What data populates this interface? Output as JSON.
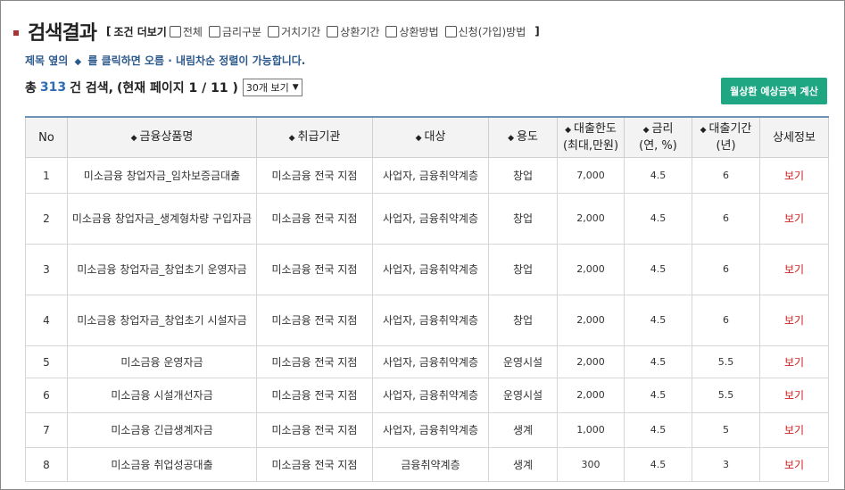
{
  "page": {
    "title": "검색결과",
    "conditions": {
      "open_bracket": "[",
      "label": "조건 더보기",
      "close_bracket": "]",
      "items": [
        "전체",
        "금리구분",
        "거치기간",
        "상환기간",
        "상환방법",
        "신청(가입)방법"
      ]
    },
    "hint": {
      "before": "제목 옆의",
      "glyph": "◆",
      "after": "를 클릭하면 오름 · 내림차순 정렬이 가능합니다."
    },
    "summary": {
      "prefix": "총",
      "total": "313",
      "suffix": "건 검색,",
      "page_text": "(현재 페이지 1 / 11 )",
      "per_page": "30개 보기"
    },
    "calc_button": "월상환 예상금액 계산"
  },
  "table": {
    "headers": [
      {
        "label": "No",
        "sortable": false
      },
      {
        "label": "금융상품명",
        "sortable": true
      },
      {
        "label": "취급기관",
        "sortable": true
      },
      {
        "label": "대상",
        "sortable": true
      },
      {
        "label": "용도",
        "sortable": true
      },
      {
        "label": "대출한도",
        "sub": "(최대,만원)",
        "sortable": true
      },
      {
        "label": "금리",
        "sub": "(연, %)",
        "sortable": true
      },
      {
        "label": "대출기간",
        "sub": "(년)",
        "sortable": true
      },
      {
        "label": "상세정보",
        "sortable": false
      }
    ],
    "rows": [
      {
        "no": "1",
        "name": "미소금융 창업자금_임차보증금대출",
        "agency": "미소금융 전국 지점",
        "target": "사업자, 금융취약계층",
        "use": "창업",
        "limit": "7,000",
        "rate": "4.5",
        "period": "6",
        "detail": "보기"
      },
      {
        "no": "2",
        "name": "미소금융 창업자금_생계형차량 구입자금",
        "agency": "미소금융 전국 지점",
        "target": "사업자, 금융취약계층",
        "use": "창업",
        "limit": "2,000",
        "rate": "4.5",
        "period": "6",
        "detail": "보기"
      },
      {
        "no": "3",
        "name": "미소금융 창업자금_창업초기 운영자금",
        "agency": "미소금융 전국 지점",
        "target": "사업자, 금융취약계층",
        "use": "창업",
        "limit": "2,000",
        "rate": "4.5",
        "period": "6",
        "detail": "보기"
      },
      {
        "no": "4",
        "name": "미소금융 창업자금_창업초기 시설자금",
        "agency": "미소금융 전국 지점",
        "target": "사업자, 금융취약계층",
        "use": "창업",
        "limit": "2,000",
        "rate": "4.5",
        "period": "6",
        "detail": "보기"
      },
      {
        "no": "5",
        "name": "미소금융 운영자금",
        "agency": "미소금융 전국 지점",
        "target": "사업자, 금융취약계층",
        "use": "운영시설",
        "limit": "2,000",
        "rate": "4.5",
        "period": "5.5",
        "detail": "보기"
      },
      {
        "no": "6",
        "name": "미소금융 시설개선자금",
        "agency": "미소금융 전국 지점",
        "target": "사업자, 금융취약계층",
        "use": "운영시설",
        "limit": "2,000",
        "rate": "4.5",
        "period": "5.5",
        "detail": "보기"
      },
      {
        "no": "7",
        "name": "미소금융 긴급생계자금",
        "agency": "미소금융 전국 지점",
        "target": "사업자, 금융취약계층",
        "use": "생계",
        "limit": "1,000",
        "rate": "4.5",
        "period": "5",
        "detail": "보기"
      },
      {
        "no": "8",
        "name": "미소금융 취업성공대출",
        "agency": "미소금융 전국 지점",
        "target": "금융취약계층",
        "use": "생계",
        "limit": "300",
        "rate": "4.5",
        "period": "3",
        "detail": "보기"
      }
    ]
  }
}
